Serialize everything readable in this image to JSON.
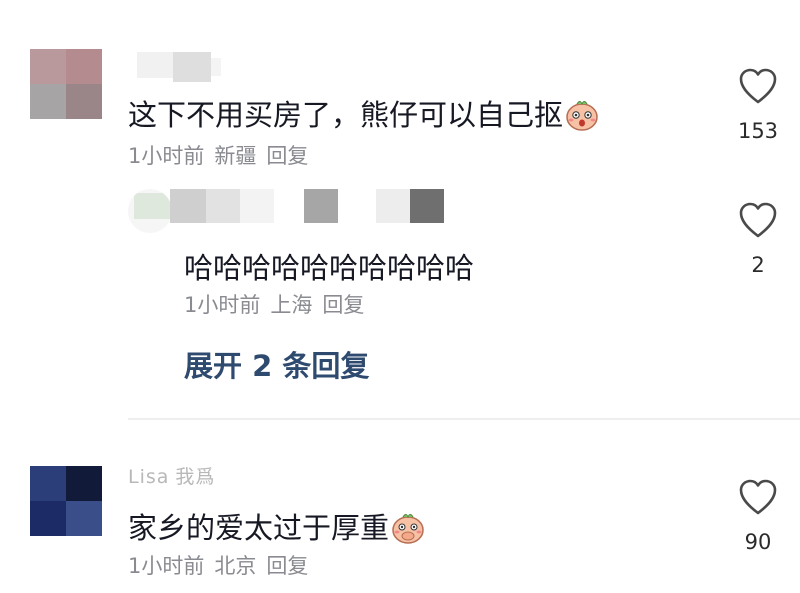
{
  "comments": [
    {
      "text": "这下不用买房了，熊仔可以自己抠",
      "time": "1小时前",
      "location": "新疆",
      "reply_label": "回复",
      "likes": "153",
      "emoji_icon": "shy-face-emoji",
      "replies": [
        {
          "text": "哈哈哈哈哈哈哈哈哈哈",
          "time": "1小时前",
          "location": "上海",
          "reply_label": "回复",
          "likes": "2"
        }
      ],
      "expand_label": "展开 2 条回复"
    },
    {
      "username": "Lisa",
      "username_suffix": "我爲",
      "text": "家乡的爱太过于厚重",
      "time": "1小时前",
      "location": "北京",
      "reply_label": "回复",
      "likes": "90",
      "emoji_icon": "shy-cover-mouth-emoji"
    }
  ],
  "icons": {
    "like": "heart-outline-icon"
  },
  "colors": {
    "link": "#2f4a6f",
    "meta": "#8a8b91",
    "divider": "#eeeeee"
  }
}
